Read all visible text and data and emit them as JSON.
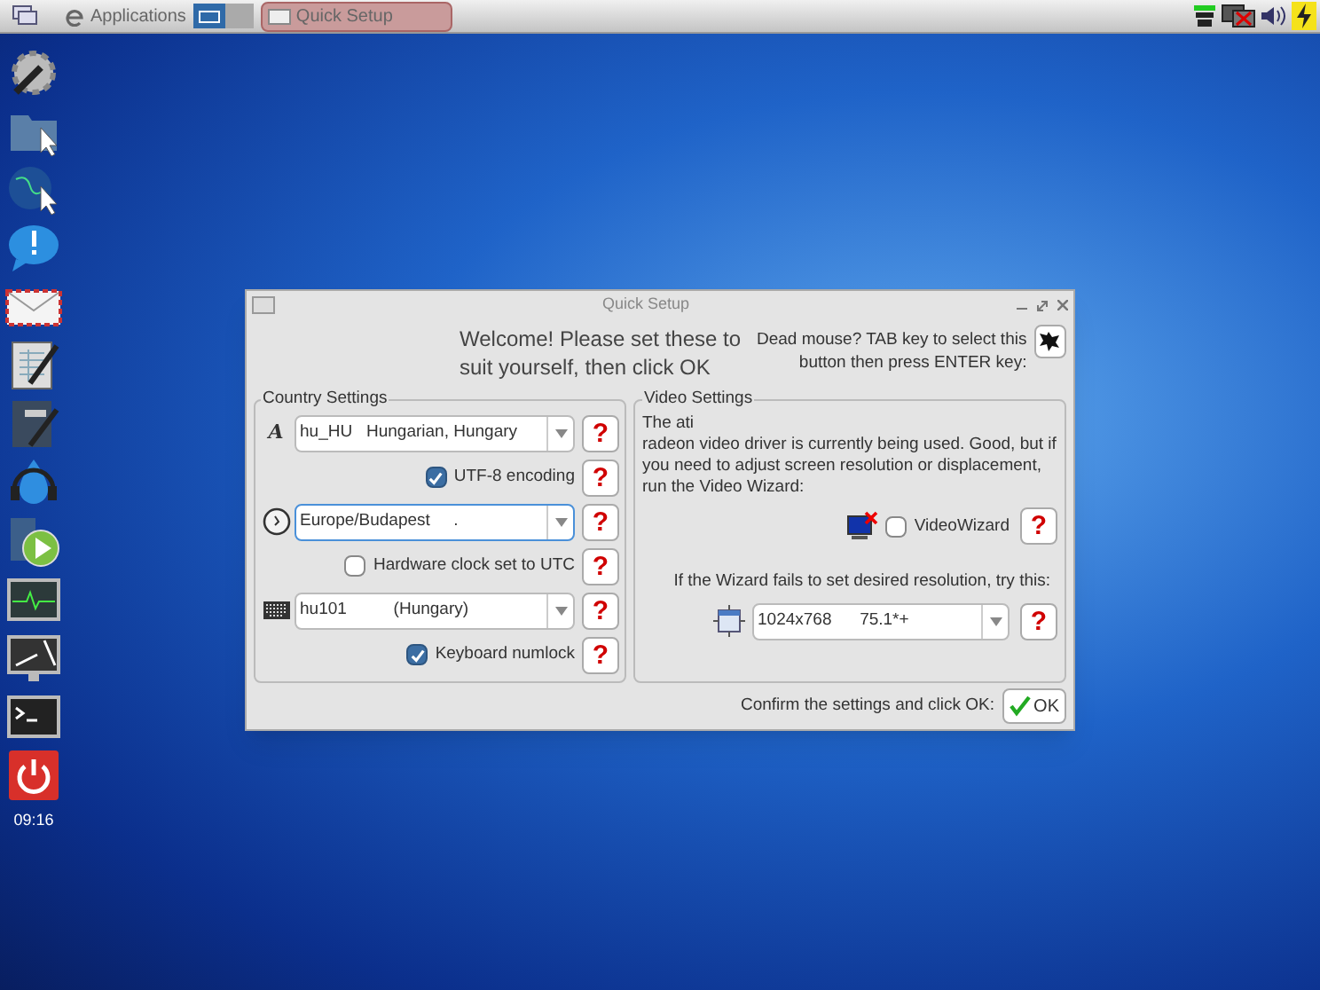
{
  "taskbar": {
    "applications": "Applications",
    "tasks": [
      {
        "title": "Quick Setup",
        "selected": true
      }
    ]
  },
  "dock": {
    "clock": "09:16"
  },
  "dialog": {
    "title": "Quick Setup",
    "welcome": "Welcome! Please set these to suit yourself, then click OK",
    "dead_mouse": "Dead mouse? TAB key to select this button then press ENTER key:",
    "country": {
      "title": "Country Settings",
      "rows": [
        {
          "kind": "combo",
          "symbol": "A",
          "value": "hu_HU   Hungarian, Hungary",
          "help": "?"
        },
        {
          "kind": "check",
          "label": "UTF-8 encoding",
          "checked": true,
          "help": "?"
        },
        {
          "kind": "combo",
          "value": "Europe/Budapest     .",
          "focused": true,
          "help": "?"
        },
        {
          "kind": "check",
          "label": "Hardware clock set to UTC",
          "checked": false,
          "help": "?"
        },
        {
          "kind": "combo",
          "value": "hu101          (Hungary)",
          "help": "?"
        },
        {
          "kind": "check",
          "label": "Keyboard numlock",
          "checked": true,
          "help": "?"
        }
      ]
    },
    "video": {
      "title": "Video Settings",
      "paragraphs": [
        "The ati",
        "radeon video driver is currently being used. Good, but if you need to adjust screen resolution or displacement, run the Video Wizard:"
      ],
      "wizard": {
        "label": "VideoWizard",
        "checked": false,
        "help": "?"
      },
      "fallback": "If the Wizard fails to set desired resolution, try this:",
      "resolution": {
        "value": "1024x768      75.1*+",
        "help": "?"
      }
    },
    "confirm": "Confirm the settings and click OK:",
    "ok": "OK"
  }
}
